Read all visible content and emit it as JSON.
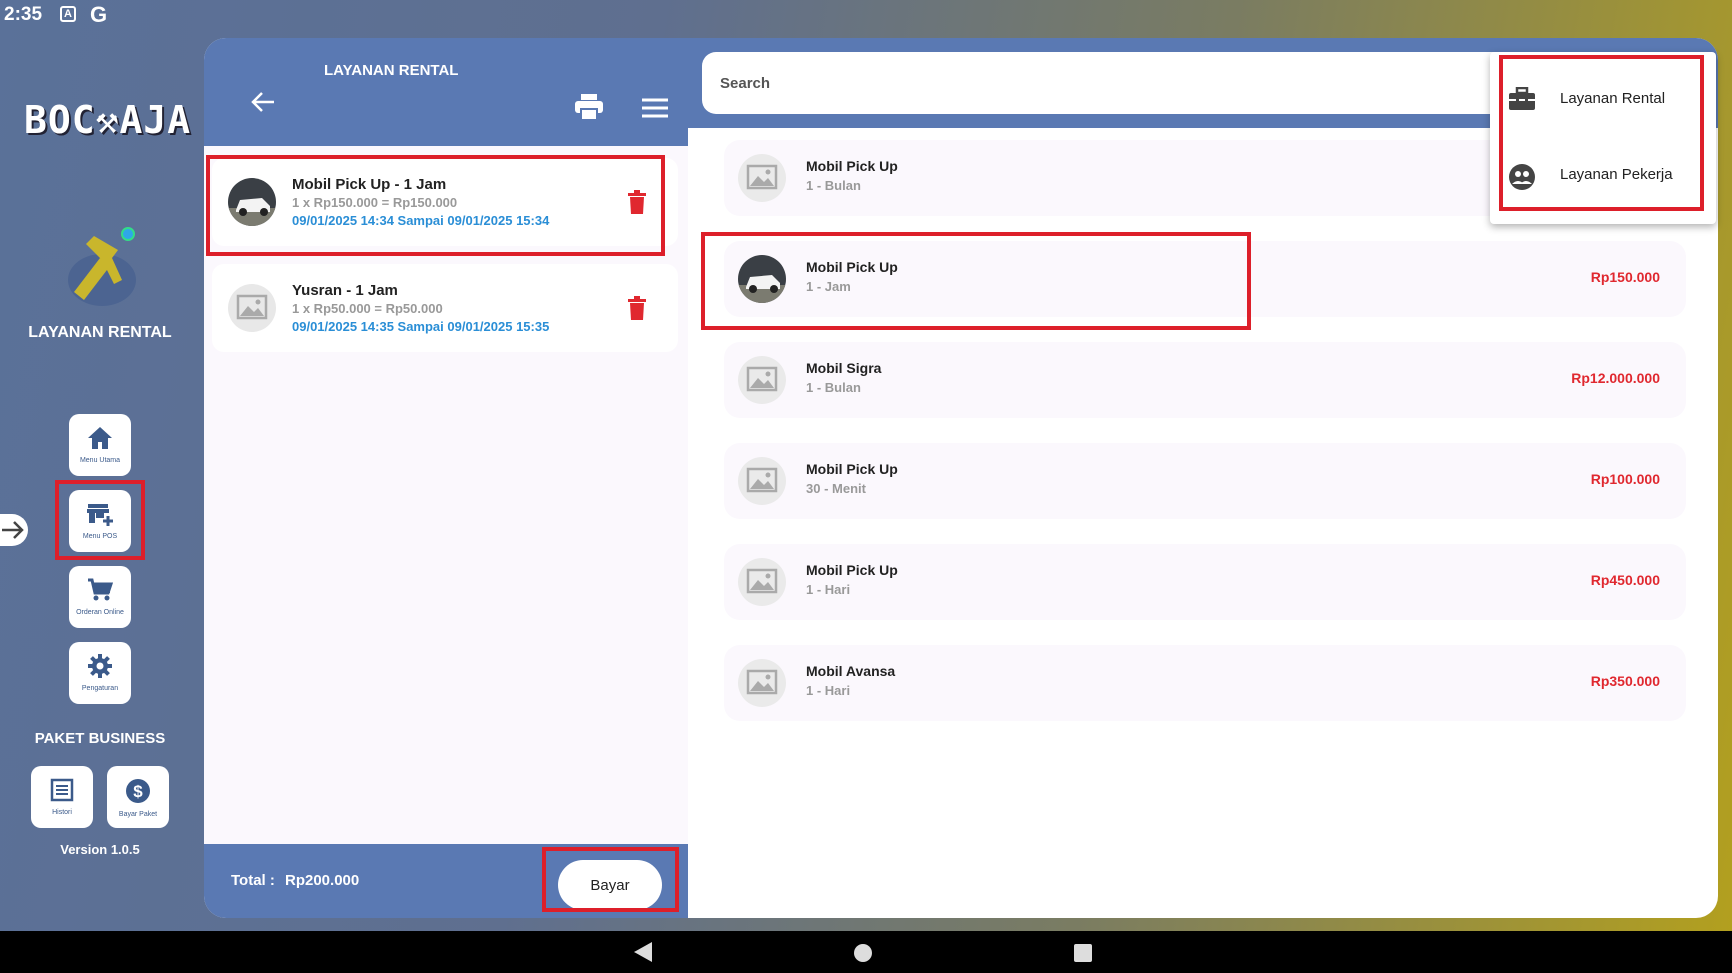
{
  "status_bar": {
    "time": "2:35",
    "icon_a": "A",
    "icon_g": "G"
  },
  "sidebar": {
    "logo": "BOC⚒AJA",
    "title": "LAYANAN RENTAL",
    "buttons": [
      {
        "label": "Menu Utama",
        "icon": "home-icon"
      },
      {
        "label": "Menu POS",
        "icon": "store-add-icon"
      },
      {
        "label": "Orderan Online",
        "icon": "cart-icon"
      },
      {
        "label": "Pengaturan",
        "icon": "gear-icon"
      }
    ],
    "paket_title": "PAKET BUSINESS",
    "paket_buttons": [
      {
        "label": "Histori",
        "icon": "list-icon"
      },
      {
        "label": "Bayar Paket",
        "icon": "dollar-icon"
      }
    ],
    "version": "Version 1.0.5"
  },
  "cart": {
    "title": "LAYANAN RENTAL",
    "items": [
      {
        "name": "Mobil Pick Up - 1 Jam",
        "calc": "1 x Rp150.000 = Rp150.000",
        "time": "09/01/2025 14:34 Sampai 09/01/2025 15:34",
        "thumb": "car-photo"
      },
      {
        "name": "Yusran - 1 Jam",
        "calc": "1 x Rp50.000 = Rp50.000",
        "time": "09/01/2025 14:35 Sampai 09/01/2025 15:35",
        "thumb": "placeholder-image"
      }
    ],
    "total_label": "Total :",
    "total_value": "Rp200.000",
    "pay_label": "Bayar"
  },
  "search": {
    "placeholder": "Search"
  },
  "products": [
    {
      "name": "Mobil Pick Up",
      "duration": "1 - Bulan",
      "price": "",
      "thumb": "placeholder-image"
    },
    {
      "name": "Mobil Pick Up",
      "duration": "1 - Jam",
      "price": "Rp150.000",
      "thumb": "car-photo"
    },
    {
      "name": "Mobil Sigra",
      "duration": "1 - Bulan",
      "price": "Rp12.000.000",
      "thumb": "placeholder-image"
    },
    {
      "name": "Mobil Pick Up",
      "duration": "30 - Menit",
      "price": "Rp100.000",
      "thumb": "placeholder-image"
    },
    {
      "name": "Mobil Pick Up",
      "duration": "1 - Hari",
      "price": "Rp450.000",
      "thumb": "placeholder-image"
    },
    {
      "name": "Mobil Avansa",
      "duration": "1 - Hari",
      "price": "Rp350.000",
      "thumb": "placeholder-image"
    }
  ],
  "dropdown": {
    "items": [
      {
        "label": "Layanan Rental",
        "icon": "toolbox-icon"
      },
      {
        "label": "Layanan Pekerja",
        "icon": "people-icon"
      }
    ]
  },
  "colors": {
    "accent": "#5a79b3",
    "price": "#e0282f",
    "time": "#2a8ed6",
    "highlight": "#dd1f2a"
  }
}
